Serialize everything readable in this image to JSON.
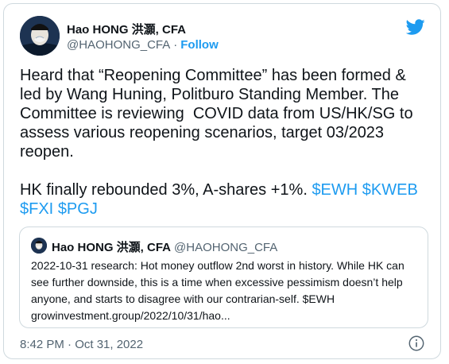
{
  "author": {
    "display_name": "Hao HONG 洪灝, CFA",
    "handle": "@HAOHONG_CFA",
    "separator": "·",
    "follow_label": "Follow"
  },
  "tweet": {
    "text_plain": "Heard that “Reopening Committee” has been formed & led by Wang Huning, Politburo Standing Member. The Committee is reviewing  COVID data from US/HK/SG to assess various reopening scenarios, target 03/2023 reopen.\n\nHK finally rebounded 3%, A-shares +1%. ",
    "cashtags": [
      "$EWH",
      "$KWEB",
      "$FXI",
      "$PGJ"
    ]
  },
  "quote": {
    "display_name": "Hao HONG 洪灝, CFA",
    "handle": "@HAOHONG_CFA",
    "text": "2022-10-31 research: Hot money outflow 2nd worst in history. While HK can see further downside, this is a time when excessive pessimism doesn’t help anyone, and starts to disagree with our contrarian-self. $EWH growinvestment.group/2022/10/31/hao..."
  },
  "timestamp": "8:42 PM · Oct 31, 2022",
  "icons": {
    "brand": "twitter-bird-icon",
    "info": "info-icon"
  },
  "colors": {
    "accent": "#1d9bf0",
    "text": "#0f1419",
    "muted": "#536471",
    "border": "#cfd9de"
  }
}
